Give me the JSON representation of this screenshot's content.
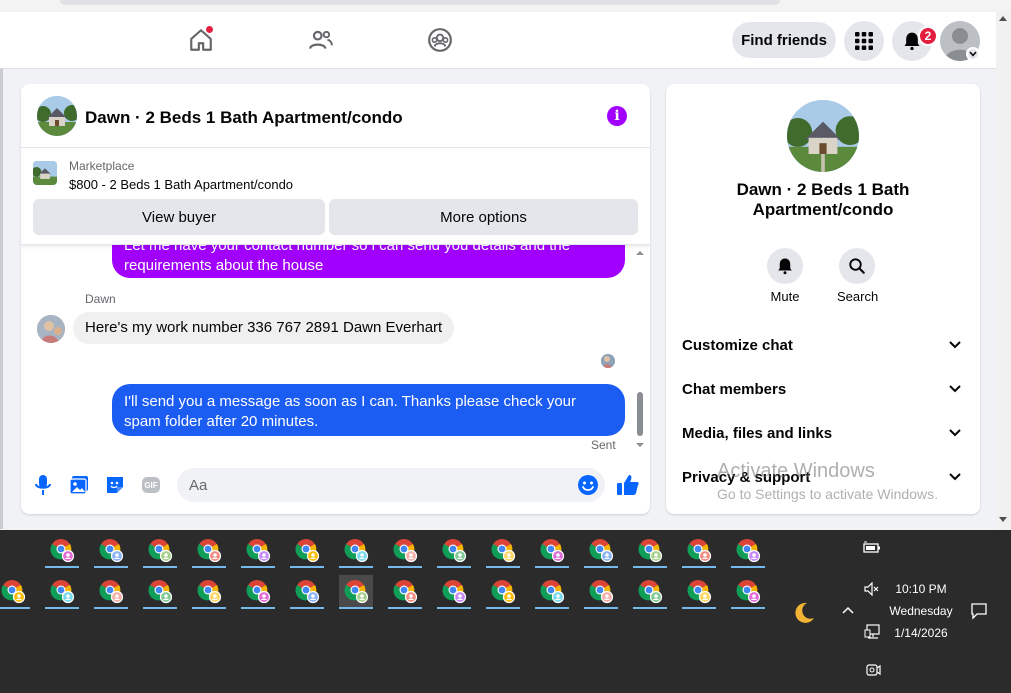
{
  "header": {
    "find_friends_label": "Find friends",
    "notification_count": "2"
  },
  "chat": {
    "title": "Dawn · 2 Beds 1 Bath Apartment/condo",
    "marketplace": {
      "label": "Marketplace",
      "listing": "$800 - 2 Beds 1 Bath Apartment/condo",
      "view_buyer_label": "View buyer",
      "more_options_label": "More options"
    },
    "messages": {
      "out1_partial": "Let me have your contact number so i can send you details and the",
      "out1_line2": "requirements about the house",
      "sender": "Dawn",
      "in1": "Here's my work number 336 767 2891    Dawn  Everhart",
      "out2": "I'll send you a message as soon as I can. Thanks please check your spam folder after 20 minutes.",
      "status": "Sent"
    },
    "composer": {
      "placeholder": "Aa",
      "gif_label": "GIF"
    }
  },
  "details": {
    "title": "Dawn · 2 Beds 1 Bath Apartment/condo",
    "mute_label": "Mute",
    "search_label": "Search",
    "sections": [
      "Customize chat",
      "Chat members",
      "Media, files and links",
      "Privacy & support"
    ]
  },
  "watermark": {
    "line1": "Activate Windows",
    "line2": "Go to Settings to activate Windows."
  },
  "taskbar": {
    "time": "10:10 PM",
    "day": "Wednesday",
    "date": "1/14/2026"
  },
  "colors": {
    "purple_bubble": "#a100ff",
    "blue_bubble": "#1b5cf2",
    "fb_blue": "#0866ff",
    "notification_red": "#e41e3f",
    "taskbar": "#2b2b2b"
  }
}
